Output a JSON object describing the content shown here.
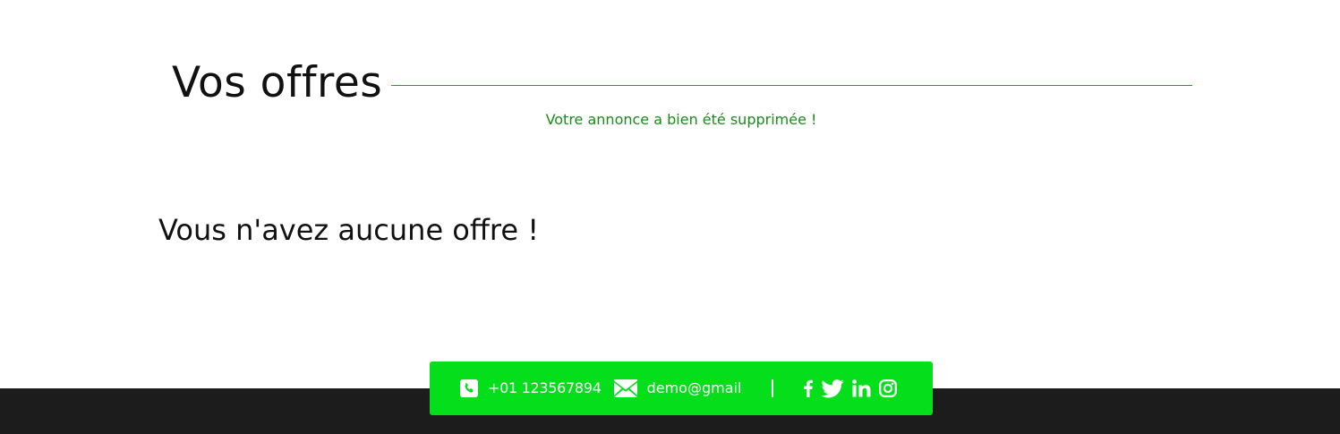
{
  "main": {
    "title": "Vos offres",
    "flash_message": "Votre annonce a bien été supprimée !",
    "empty_message": "Vous n'avez aucune offre !"
  },
  "footer": {
    "phone": "+01 123567894",
    "email": "demo@gmail",
    "social_icons": [
      "facebook-icon",
      "twitter-icon",
      "linkedin-icon",
      "instagram-icon"
    ]
  },
  "colors": {
    "accent_green": "#05de1a",
    "title_line": "#1ea21e",
    "flash_text": "#1b8a1b",
    "footer_background": "#1c1c1c"
  }
}
